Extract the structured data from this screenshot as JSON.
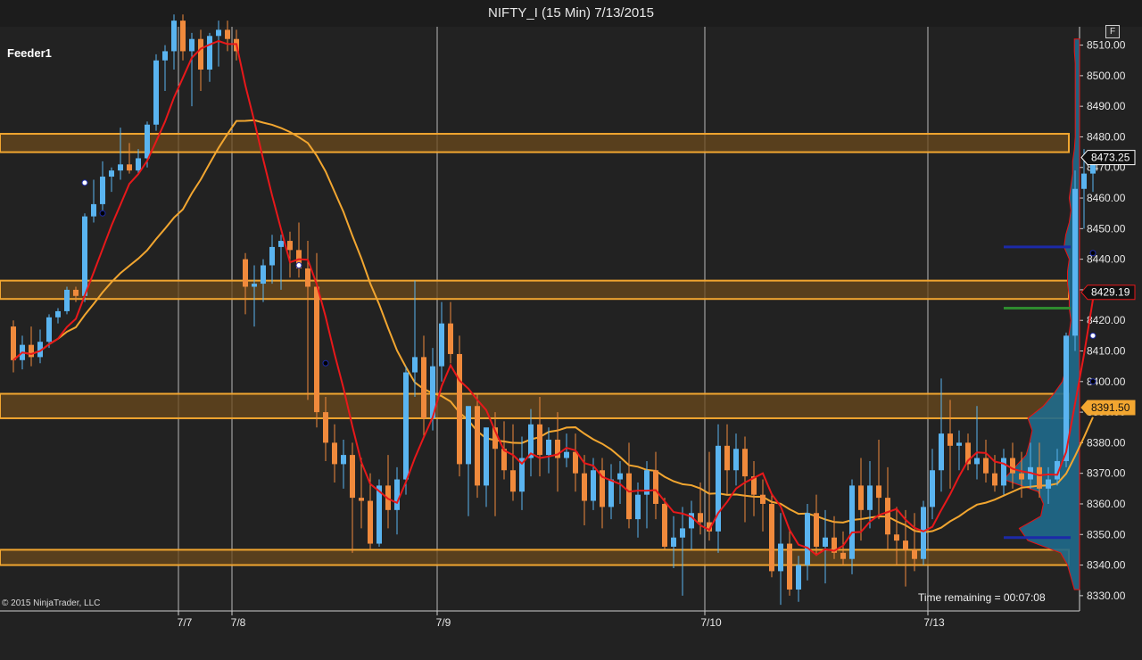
{
  "window": {
    "title": "NIFTY_I (15 Min)  7/13/2015"
  },
  "panel": {
    "label": "Feeder1",
    "button": "F"
  },
  "footer": {
    "copyright": "© 2015 NinjaTrader, LLC",
    "time_remaining": "Time remaining = 00:07:08"
  },
  "colors": {
    "background": "#222222",
    "up_candle": "#5ab4f0",
    "down_candle": "#f08a3c",
    "fast_ma": "#e8181a",
    "slow_ma": "#f2a630",
    "zone_fill": "#6b4a1c",
    "zone_border": "#f2a630",
    "blue_line": "#1c2aa8",
    "green_line": "#2e8b2e",
    "profile": "#1f6a8c"
  },
  "chart_data": {
    "type": "candlestick",
    "symbol": "NIFTY_I",
    "interval": "15 Min",
    "date": "7/13/2015",
    "ylim": [
      8325,
      8516
    ],
    "y_ticks": [
      8510,
      8500,
      8490,
      8480,
      8470,
      8460,
      8450,
      8440,
      8430,
      8420,
      8410,
      8400,
      8390,
      8380,
      8370,
      8360,
      8350,
      8340,
      8330
    ],
    "y_tick_format": "0.00",
    "x_labels": [
      "7/7",
      "7/8",
      "7/9",
      "7/10",
      "7/13"
    ],
    "grid": true,
    "price_labels": [
      {
        "label": "8473.25",
        "value": 8473.25,
        "style": "last"
      },
      {
        "label": "8429.19",
        "value": 8429.19,
        "style": "red"
      },
      {
        "label": "8391.50",
        "value": 8391.5,
        "style": "orange"
      }
    ],
    "zones": [
      {
        "low": 8475,
        "high": 8481
      },
      {
        "low": 8427,
        "high": 8433
      },
      {
        "low": 8388,
        "high": 8396
      },
      {
        "low": 8340,
        "high": 8345
      }
    ],
    "sessions": [
      {
        "label": "",
        "bars": [
          [
            8418,
            8420,
            8403,
            8407
          ],
          [
            8407,
            8415,
            8404,
            8412
          ],
          [
            8412,
            8418,
            8405,
            8408
          ],
          [
            8408,
            8417,
            8406,
            8413
          ],
          [
            8413,
            8422,
            8411,
            8421
          ],
          [
            8421,
            8424,
            8419,
            8423
          ],
          [
            8423,
            8431,
            8422,
            8430
          ],
          [
            8430,
            8431,
            8426,
            8428
          ],
          [
            8428,
            8455,
            8426,
            8454
          ],
          [
            8454,
            8466,
            8452,
            8458
          ],
          [
            8458,
            8472,
            8456,
            8467
          ],
          [
            8467,
            8470,
            8462,
            8469
          ],
          [
            8469,
            8483,
            8466,
            8471
          ],
          [
            8471,
            8478,
            8468,
            8469
          ],
          [
            8469,
            8476,
            8468,
            8473
          ],
          [
            8473,
            8485,
            8470,
            8484
          ],
          [
            8484,
            8507,
            8482,
            8505
          ],
          [
            8505,
            8510,
            8495,
            8508
          ],
          [
            8508,
            8520,
            8502,
            8518
          ]
        ]
      },
      {
        "label": "7/7",
        "bars": [
          [
            8518,
            8520,
            8505,
            8508
          ],
          [
            8508,
            8514,
            8490,
            8512
          ],
          [
            8512,
            8515,
            8495,
            8502
          ],
          [
            8502,
            8514,
            8498,
            8513
          ],
          [
            8513,
            8518,
            8503,
            8515
          ],
          [
            8515,
            8518,
            8508,
            8512
          ]
        ]
      },
      {
        "label": "7/8",
        "bars": [
          [
            8512,
            8515,
            8505,
            8508
          ],
          [
            8440,
            8442,
            8422,
            8431
          ],
          [
            8431,
            8438,
            8418,
            8432
          ],
          [
            8432,
            8440,
            8426,
            8438
          ],
          [
            8438,
            8448,
            8432,
            8444
          ],
          [
            8444,
            8448,
            8430,
            8446
          ],
          [
            8446,
            8449,
            8434,
            8443
          ],
          [
            8443,
            8452,
            8434,
            8437
          ],
          [
            8437,
            8446,
            8394,
            8431
          ],
          [
            8431,
            8442,
            8385,
            8390
          ],
          [
            8390,
            8395,
            8374,
            8380
          ],
          [
            8380,
            8386,
            8367,
            8373
          ],
          [
            8373,
            8381,
            8365,
            8376
          ],
          [
            8376,
            8380,
            8344,
            8362
          ],
          [
            8362,
            8375,
            8352,
            8361
          ],
          [
            8361,
            8370,
            8345,
            8347
          ],
          [
            8347,
            8368,
            8346,
            8366
          ],
          [
            8366,
            8376,
            8352,
            8358
          ],
          [
            8358,
            8372,
            8350,
            8368
          ],
          [
            8368,
            8405,
            8363,
            8403
          ],
          [
            8403,
            8433,
            8395,
            8408
          ],
          [
            8408,
            8415,
            8382,
            8388
          ],
          [
            8388,
            8411,
            8384,
            8405
          ]
        ]
      },
      {
        "label": "7/9",
        "bars": [
          [
            8405,
            8426,
            8400,
            8419
          ],
          [
            8419,
            8426,
            8406,
            8409
          ],
          [
            8409,
            8415,
            8369,
            8373
          ],
          [
            8373,
            8387,
            8356,
            8392
          ],
          [
            8392,
            8396,
            8362,
            8366
          ],
          [
            8366,
            8376,
            8359,
            8385
          ],
          [
            8385,
            8390,
            8356,
            8378
          ],
          [
            8378,
            8387,
            8368,
            8371
          ],
          [
            8371,
            8386,
            8361,
            8364
          ],
          [
            8364,
            8382,
            8358,
            8375
          ],
          [
            8375,
            8391,
            8369,
            8386
          ],
          [
            8386,
            8395,
            8369,
            8376
          ],
          [
            8376,
            8385,
            8370,
            8381
          ],
          [
            8381,
            8390,
            8364,
            8375
          ],
          [
            8375,
            8383,
            8372,
            8377
          ],
          [
            8377,
            8383,
            8364,
            8370
          ],
          [
            8370,
            8376,
            8353,
            8361
          ],
          [
            8361,
            8375,
            8358,
            8371
          ],
          [
            8371,
            8375,
            8352,
            8359
          ],
          [
            8359,
            8373,
            8355,
            8368
          ],
          [
            8368,
            8374,
            8360,
            8370
          ],
          [
            8370,
            8380,
            8352,
            8355
          ],
          [
            8355,
            8367,
            8349,
            8363
          ],
          [
            8363,
            8374,
            8352,
            8371
          ],
          [
            8371,
            8377,
            8355,
            8360
          ],
          [
            8360,
            8362,
            8345,
            8346
          ],
          [
            8346,
            8356,
            8339,
            8349
          ],
          [
            8349,
            8359,
            8330,
            8352
          ],
          [
            8352,
            8361,
            8345,
            8357
          ],
          [
            8357,
            8367,
            8350,
            8354
          ]
        ]
      },
      {
        "label": "7/10",
        "bars": [
          [
            8354,
            8377,
            8348,
            8351
          ],
          [
            8351,
            8386,
            8344,
            8379
          ],
          [
            8379,
            8386,
            8363,
            8371
          ],
          [
            8371,
            8383,
            8366,
            8378
          ],
          [
            8378,
            8382,
            8354,
            8369
          ],
          [
            8369,
            8374,
            8356,
            8363
          ],
          [
            8363,
            8368,
            8351,
            8360
          ],
          [
            8360,
            8363,
            8336,
            8338
          ],
          [
            8338,
            8357,
            8327,
            8347
          ],
          [
            8347,
            8352,
            8330,
            8332
          ],
          [
            8332,
            8343,
            8328,
            8340
          ],
          [
            8340,
            8360,
            8335,
            8357
          ],
          [
            8357,
            8363,
            8343,
            8346
          ],
          [
            8346,
            8358,
            8334,
            8349
          ],
          [
            8349,
            8356,
            8342,
            8344
          ],
          [
            8344,
            8351,
            8340,
            8342
          ],
          [
            8342,
            8368,
            8337,
            8366
          ],
          [
            8366,
            8375,
            8348,
            8358
          ],
          [
            8358,
            8374,
            8352,
            8366
          ],
          [
            8366,
            8381,
            8355,
            8362
          ],
          [
            8362,
            8372,
            8345,
            8350
          ],
          [
            8350,
            8359,
            8340,
            8348
          ],
          [
            8348,
            8358,
            8333,
            8345
          ],
          [
            8345,
            8357,
            8338,
            8342
          ],
          [
            8342,
            8361,
            8340,
            8359
          ]
        ]
      },
      {
        "label": "7/13",
        "bars": [
          [
            8359,
            8378,
            8355,
            8371
          ],
          [
            8371,
            8401,
            8364,
            8383
          ],
          [
            8383,
            8394,
            8365,
            8379
          ],
          [
            8379,
            8384,
            8371,
            8380
          ],
          [
            8380,
            8383,
            8371,
            8373
          ],
          [
            8373,
            8392,
            8368,
            8375
          ],
          [
            8375,
            8381,
            8367,
            8370
          ],
          [
            8370,
            8376,
            8364,
            8366
          ],
          [
            8366,
            8378,
            8363,
            8375
          ],
          [
            8375,
            8380,
            8365,
            8370
          ],
          [
            8370,
            8377,
            8362,
            8368
          ],
          [
            8368,
            8380,
            8365,
            8372
          ],
          [
            8372,
            8380,
            8362,
            8365
          ],
          [
            8365,
            8372,
            8360,
            8368
          ],
          [
            8368,
            8378,
            8366,
            8374
          ],
          [
            8374,
            8416,
            8372,
            8415
          ],
          [
            8415,
            8469,
            8410,
            8463
          ],
          [
            8463,
            8476,
            8450,
            8468
          ],
          [
            8468,
            8475,
            8462,
            8473
          ]
        ]
      }
    ],
    "markers": [
      {
        "value": 8465,
        "color": "#ffffff"
      },
      {
        "value": 8455,
        "color": "#000000"
      },
      {
        "value": 8438,
        "color": "#ffffff"
      },
      {
        "value": 8406,
        "color": "#000000"
      },
      {
        "value": 8473,
        "color": "#ffffff"
      },
      {
        "value": 8442,
        "color": "#000000"
      },
      {
        "value": 8415,
        "color": "#ffffff"
      },
      {
        "value": 8400,
        "color": "#000000"
      }
    ],
    "volume_profile": {
      "bins": [
        8332,
        8336,
        8340,
        8344,
        8348,
        8352,
        8356,
        8360,
        8364,
        8368,
        8372,
        8376,
        8380,
        8384,
        8388,
        8392,
        8396,
        8400,
        8404,
        8408,
        8412,
        8416,
        8420,
        8424,
        8428,
        8432,
        8436,
        8440,
        8444,
        8448,
        8452,
        8456,
        8460,
        8464,
        8468,
        8472,
        8476,
        8480,
        8484,
        8488,
        8492,
        8496,
        8500,
        8504,
        8508,
        8512
      ],
      "volume": [
        6,
        10,
        14,
        22,
        60,
        70,
        45,
        42,
        48,
        88,
        75,
        62,
        58,
        55,
        60,
        42,
        30,
        20,
        16,
        18,
        14,
        12,
        10,
        12,
        12,
        14,
        14,
        12,
        18,
        16,
        12,
        10,
        12,
        10,
        8,
        8,
        6,
        5,
        5,
        5,
        5,
        5,
        5,
        5,
        6,
        6
      ]
    },
    "volume_levels": [
      {
        "value": 8444,
        "color": "#1c2aa8"
      },
      {
        "value": 8424,
        "color": "#2e8b2e"
      },
      {
        "value": 8349,
        "color": "#1c2aa8"
      }
    ]
  }
}
